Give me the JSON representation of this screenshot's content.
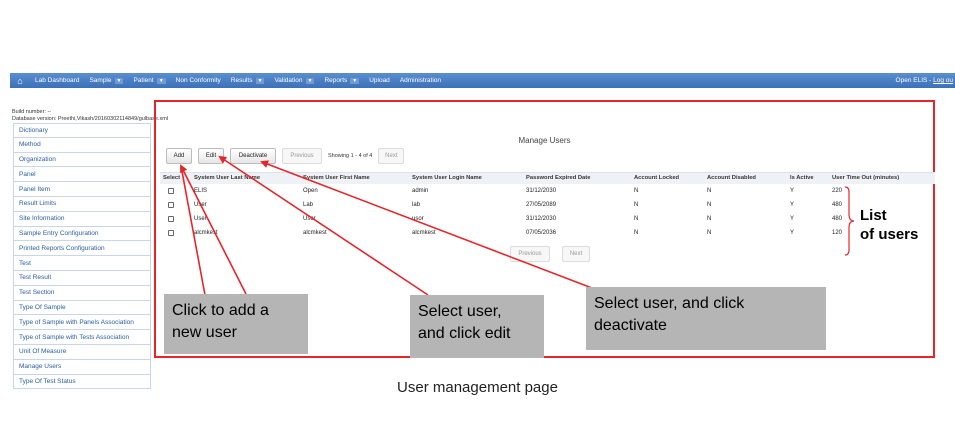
{
  "navbar": {
    "home_icon": "home-icon",
    "items": [
      {
        "label": "Lab Dashboard",
        "dropdown": false
      },
      {
        "label": "Sample",
        "dropdown": true
      },
      {
        "label": "Patient",
        "dropdown": true
      },
      {
        "label": "Non Conformity",
        "dropdown": false
      },
      {
        "label": "Results",
        "dropdown": true
      },
      {
        "label": "Validation",
        "dropdown": true
      },
      {
        "label": "Reports",
        "dropdown": true
      },
      {
        "label": "Upload",
        "dropdown": false
      },
      {
        "label": "Administration",
        "dropdown": false
      }
    ],
    "right_text": "Open ELIS - ",
    "logout": "Log ou"
  },
  "build": {
    "line1": "Build number: --",
    "line2": "Database version: Preethi,Vikash/20160302114849/gulbase.xml"
  },
  "sidebar": {
    "items": [
      "Dictionary",
      "Method",
      "Organization",
      "Panel",
      "Panel Item",
      "Result Limits",
      "Site Information",
      "Sample Entry Configuration",
      "Printed Reports Configuration",
      "Test",
      "Test Result",
      "Test Section",
      "Type Of Sample",
      "Type of Sample with Panels Association",
      "Type of Sample with Tests Association",
      "Unit Of Measure",
      "Manage Users",
      "Type Of Test Status"
    ]
  },
  "main": {
    "title": "Manage Users",
    "toolbar": {
      "add": "Add",
      "edit": "Edit",
      "deactivate": "Deactivate",
      "previous": "Previous",
      "showing": "Showing 1 - 4 of 4",
      "next": "Next"
    },
    "columns": [
      "Select",
      "System User Last Name",
      "System User First Name",
      "System User Login Name",
      "Password Expired Date",
      "Account Locked",
      "Account Disabled",
      "Is Active",
      "User Time Out (minutes)"
    ],
    "rows": [
      {
        "last": "ELIS",
        "first": "Open",
        "login": "admin",
        "expires": "31/12/2030",
        "locked": "N",
        "disabled": "N",
        "active": "Y",
        "timeout": "220"
      },
      {
        "last": "User",
        "first": "Lab",
        "login": "lab",
        "expires": "27/05/2089",
        "locked": "N",
        "disabled": "N",
        "active": "Y",
        "timeout": "480"
      },
      {
        "last": "User",
        "first": "User",
        "login": "usor",
        "expires": "31/12/2030",
        "locked": "N",
        "disabled": "N",
        "active": "Y",
        "timeout": "480"
      },
      {
        "last": "alcmkest",
        "first": "alcmkest",
        "login": "alcmkest",
        "expires": "07/05/2036",
        "locked": "N",
        "disabled": "N",
        "active": "Y",
        "timeout": "120"
      }
    ],
    "pager_bottom": {
      "previous": "Previous",
      "next": "Next"
    }
  },
  "annotations": {
    "list_label_1": "List",
    "list_label_2": "of users",
    "add_callout_1": "Click to add a",
    "add_callout_2": "new user",
    "edit_callout_1": "Select user,",
    "edit_callout_2": "and click edit",
    "deact_callout_1": "Select user, and click",
    "deact_callout_2": "deactivate",
    "highlight_color": "#e5262b",
    "callout_color": "#b5b5b5"
  },
  "caption": "User management page"
}
